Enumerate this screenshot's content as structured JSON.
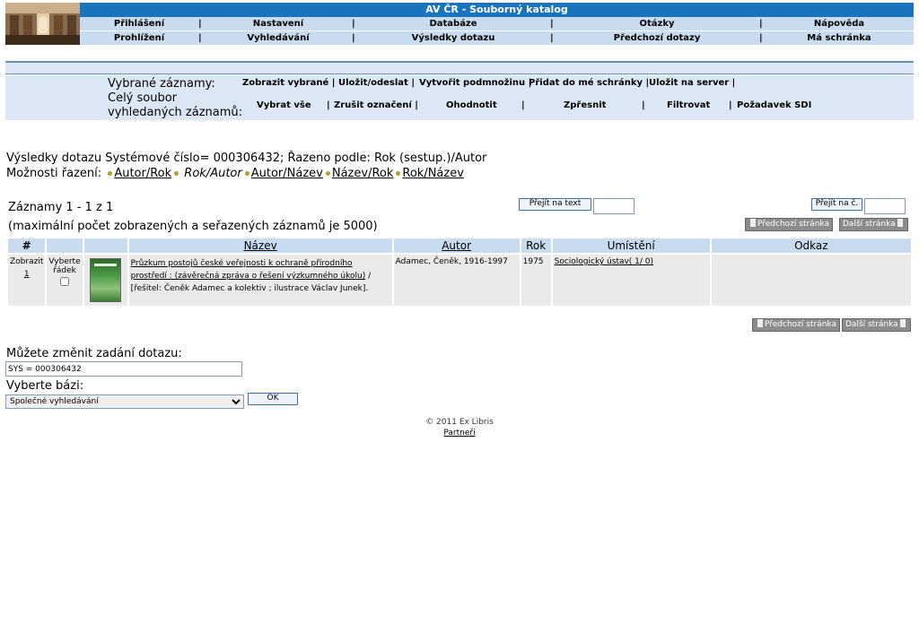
{
  "header": {
    "title": "AV ČR - Souborný katalog",
    "menu_row1": [
      "Přihlášení",
      "Nastavení",
      "Databáze",
      "Otázky",
      "Nápověda"
    ],
    "menu_row2": [
      "Prohlížení",
      "Vyhledávání",
      "Výsledky dotazu",
      "Předchozí dotazy",
      "Má schránka"
    ],
    "separator": "|"
  },
  "selection": {
    "selected_label": "Vybrané záznamy:",
    "all_label_line1": "Celý soubor",
    "all_label_line2": "vyhledaných záznamů:",
    "selected_actions": [
      "Zobrazit vybrané",
      "Uložit/odeslat",
      "Vytvořit podmnožinu",
      "Přidat do mé schránky",
      "Uložit na server"
    ],
    "all_actions": [
      "Vybrat vše",
      "Zrušit označení",
      "Ohodnotit",
      "Zpřesnit",
      "Filtrovat",
      "Požadavek SDI"
    ]
  },
  "results": {
    "summary": "Výsledky dotazu Systémové číslo= 000306432; Řazeno podle: Rok (sestup.)/Autor",
    "sort_label": "Možnosti řazení:",
    "sort_options": [
      "Autor/Rok",
      "Rok/Autor",
      "Autor/Název",
      "Název/Rok",
      "Rok/Název"
    ],
    "records": "Záznamy 1 - 1 z 1",
    "max_note": "(maximální počet zobrazených a seřazených záznamů je 5000)",
    "goto_text_btn": "Přejít na text",
    "goto_num_btn": "Přejít na č.",
    "prev_page": "Předchozí stránka",
    "next_page": "Další stránka"
  },
  "table": {
    "headers": [
      "#",
      "",
      "",
      "Název",
      "Autor",
      "Rok",
      "Umístění",
      "Odkaz"
    ],
    "rows": [
      {
        "show": "Zobrazit",
        "num": "1",
        "select_label_1": "Vyberte",
        "select_label_2": "řádek",
        "title_link": "Průzkum postojů české veřejnosti k ochraně přírodního prostředí : (závěrečná zpráva o řešení výzkumného úkolu)",
        "title_rest": " / [řešitel: Čeněk Adamec a kolektiv ; ilustrace Václav Junek].",
        "author": "Adamec, Čeněk, 1916-1997",
        "year": "1975",
        "location": "Sociologický ústav( 1/ 0)",
        "link": ""
      }
    ]
  },
  "query": {
    "change_label": "Můžete změnit zadání dotazu:",
    "query_value": "SYS = 000306432",
    "base_label": "Vyberte bázi:",
    "base_selected": "Společné vyhledávání",
    "ok": "OK"
  },
  "footer": {
    "copyright": "© 2011 Ex Libris",
    "partners": "Partneři"
  },
  "colors": {
    "title_bar": "#1a73bd",
    "menu_bg": "#c9dcef",
    "band_bg": "#dbe7f4"
  }
}
